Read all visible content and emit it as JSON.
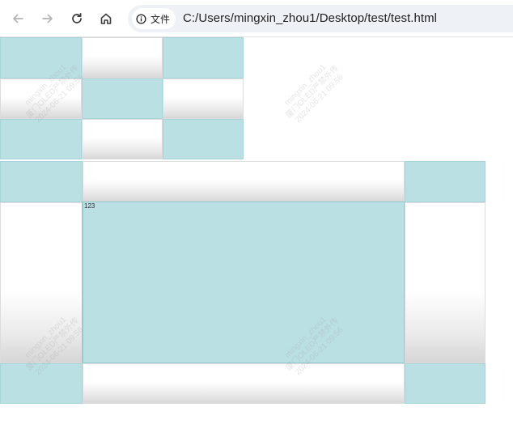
{
  "browser": {
    "back_icon": "arrow-left-icon",
    "forward_icon": "arrow-right-icon",
    "reload_icon": "reload-icon",
    "home_icon": "home-icon",
    "site_info_icon": "info-icon",
    "site_chip_label": "文件",
    "url": "C:/Users/mingxin_zhou1/Desktop/test/test.html"
  },
  "page": {
    "center_label": "123",
    "watermark": {
      "line1": "mingxin_zhou1",
      "line2": "厦门OLED严禁外传",
      "line3": "2024-06-21 09:56"
    },
    "colors": {
      "teal": "#bbe0e3",
      "teal_border": "#8fcdd1",
      "gradient_light": "#ffffff",
      "gradient_dark": "#d7d7d7"
    }
  }
}
